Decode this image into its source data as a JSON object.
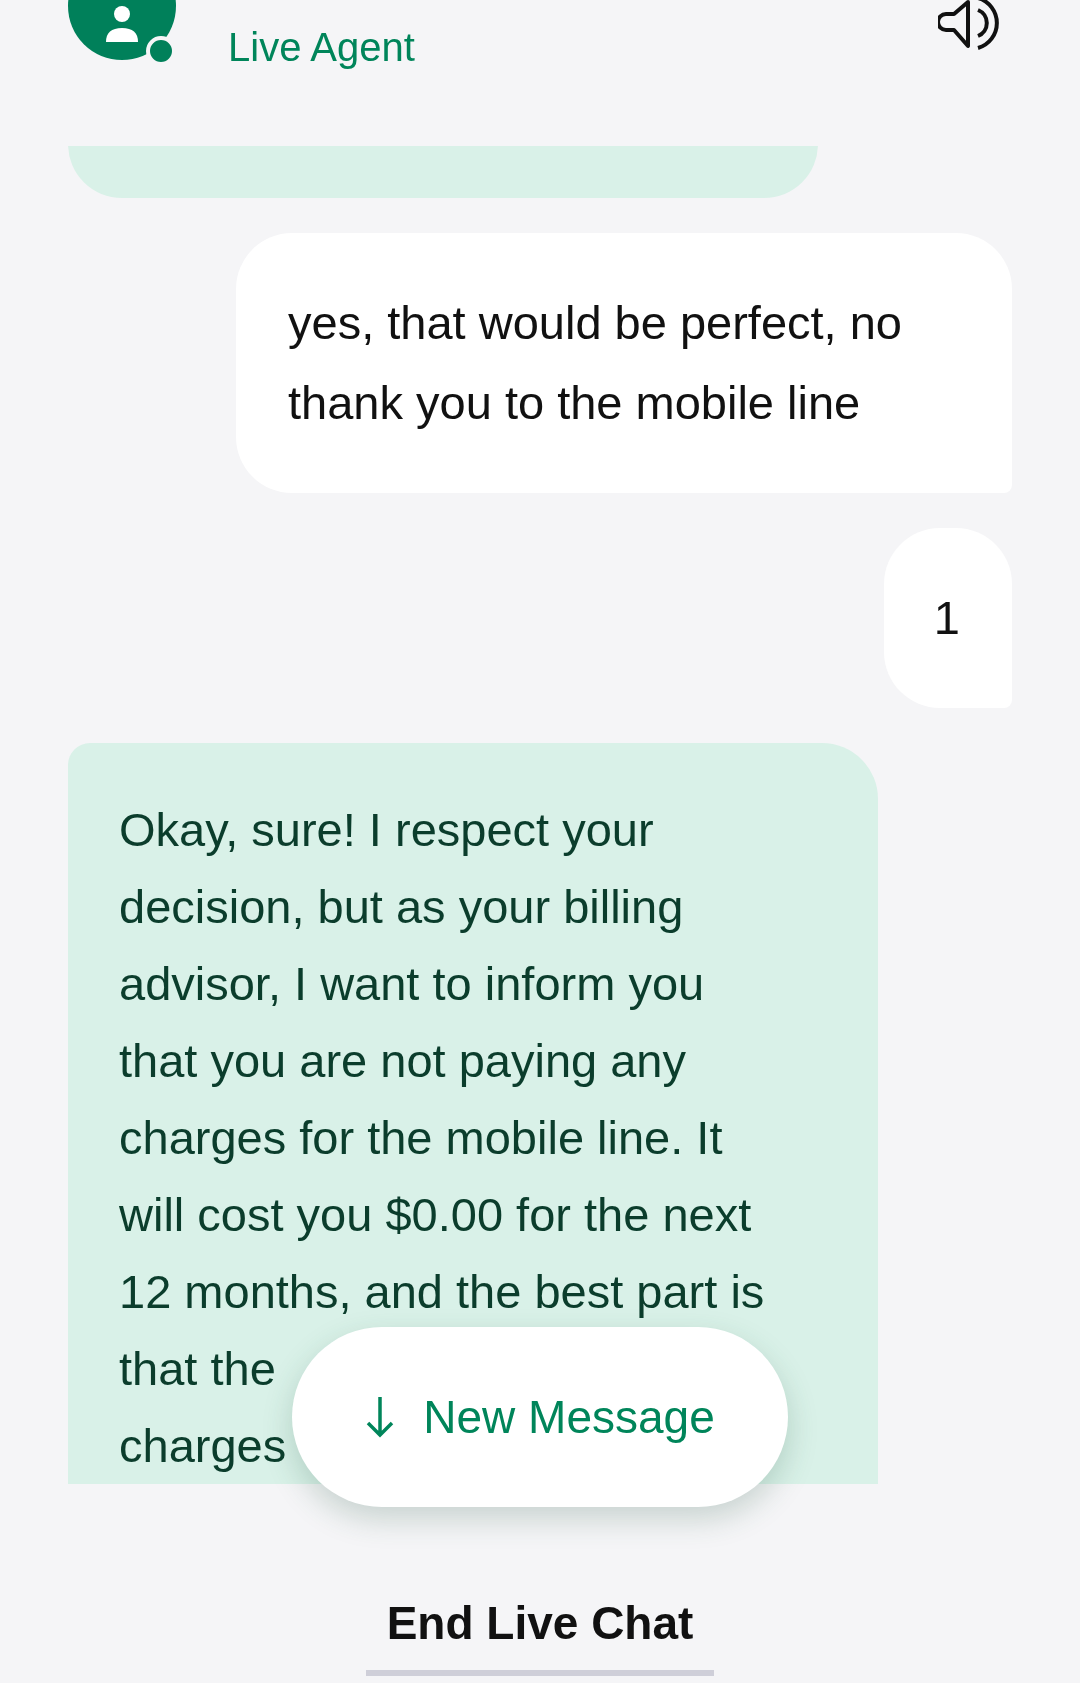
{
  "header": {
    "agent_status": "Live Agent",
    "online": true
  },
  "messages": [
    {
      "kind": "agent"
    },
    {
      "kind": "user",
      "lines": [
        "yes, that would be perfect, no",
        "thank you to the mobile line"
      ]
    },
    {
      "kind": "user",
      "lines": [
        "1"
      ]
    },
    {
      "kind": "agent",
      "lines": [
        "Okay, sure! I respect your",
        "decision, but as your billing",
        "advisor, I want to inform you",
        "that you are not paying any",
        "charges for the mobile line. It",
        "will cost you $0.00 for the next",
        "12 months, and the best part is",
        "that the",
        "charges"
      ]
    }
  ],
  "new_message_button": {
    "label": "New Message"
  },
  "end_chat_button": {
    "label": "End Live Chat"
  }
}
